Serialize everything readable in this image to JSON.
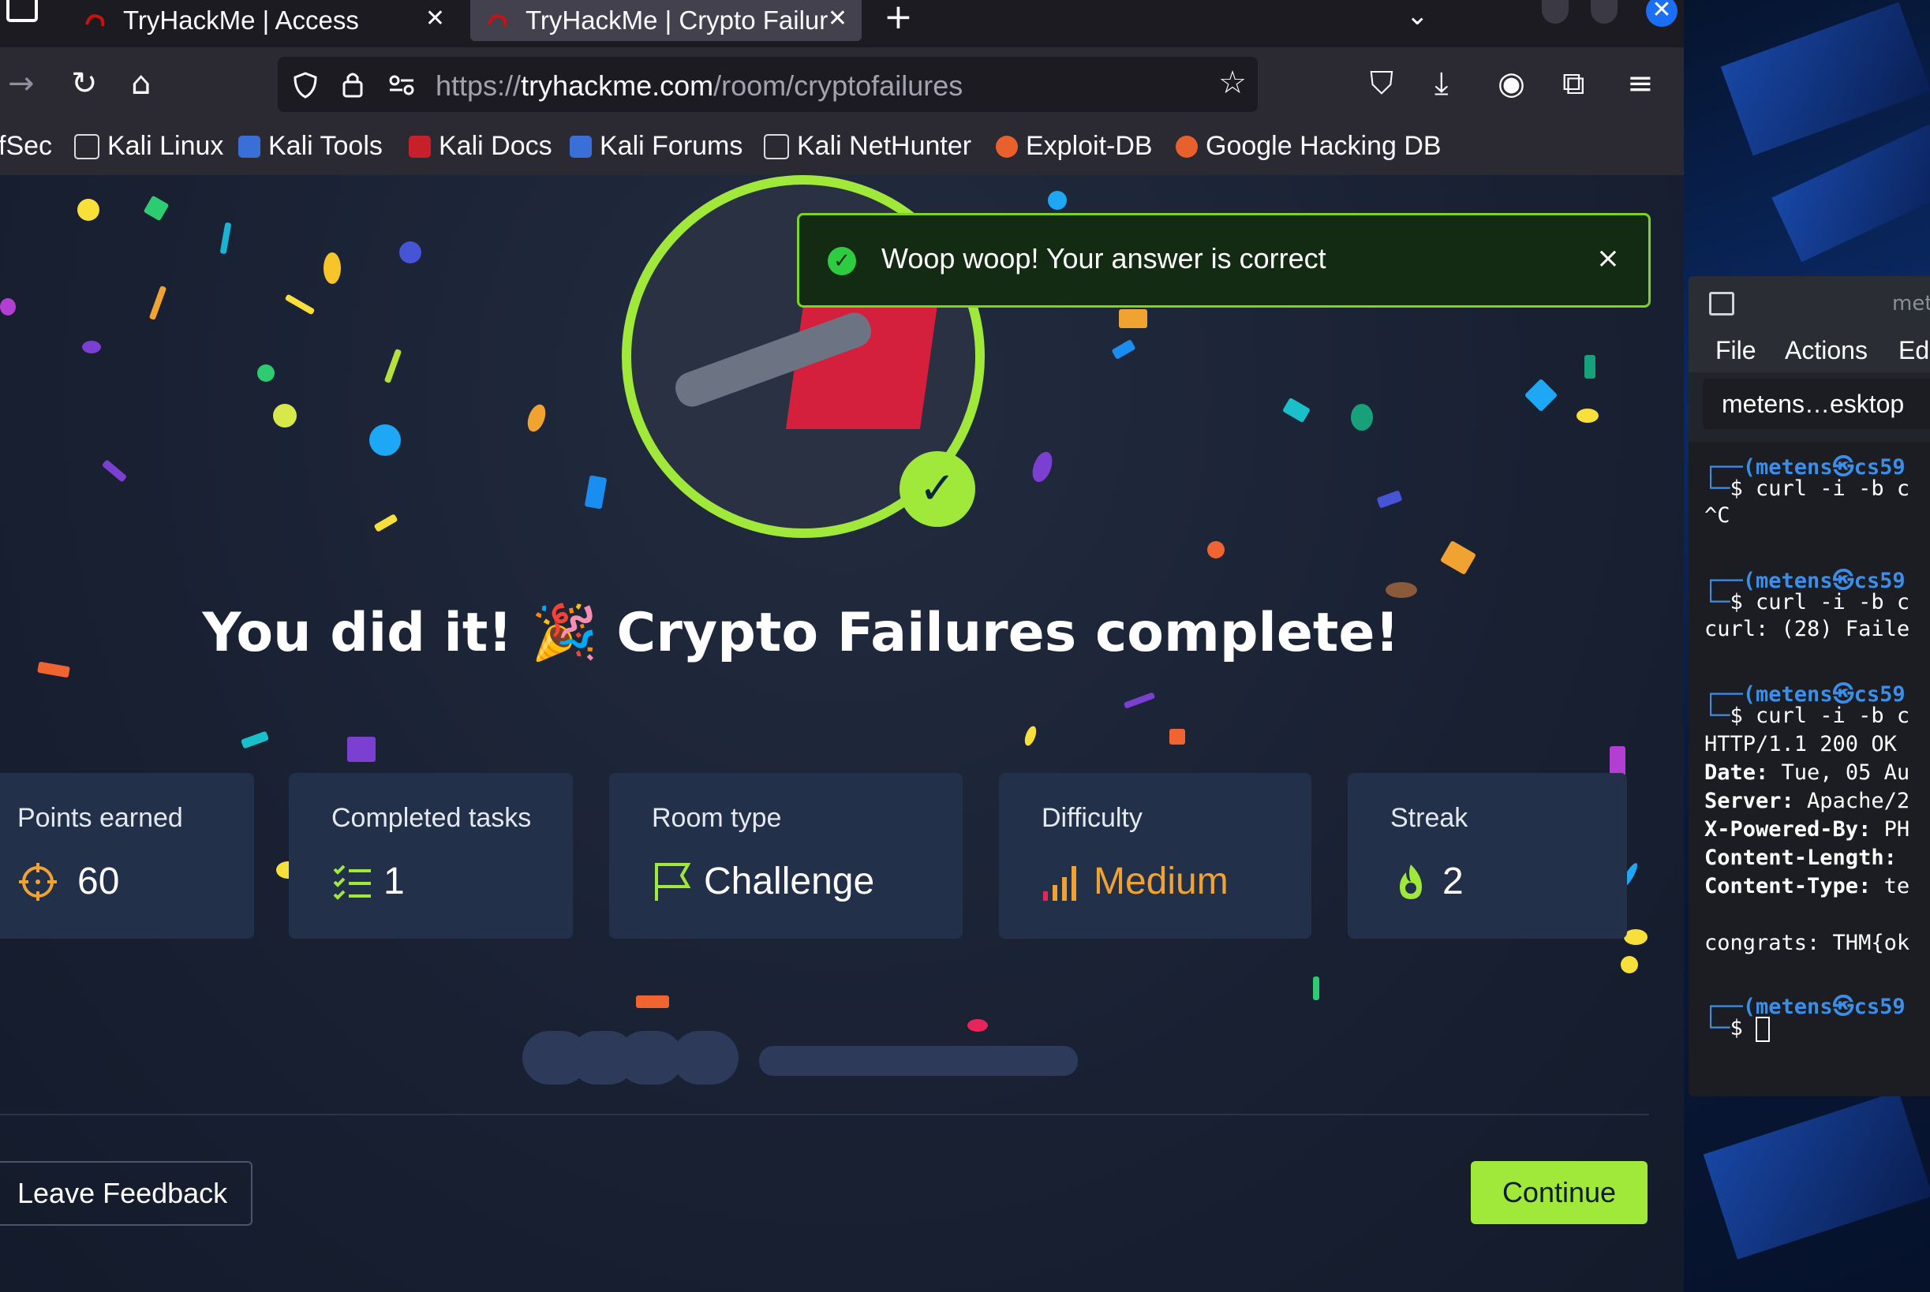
{
  "browser": {
    "tabs": [
      {
        "title": "TryHackMe | Access",
        "active": false
      },
      {
        "title": "TryHackMe | Crypto Failur",
        "active": true
      }
    ],
    "url": {
      "scheme": "https://",
      "host": "tryhackme.com",
      "path": "/room/cryptofailures"
    },
    "bookmarks": [
      "fSec",
      "Kali Linux",
      "Kali Tools",
      "Kali Docs",
      "Kali Forums",
      "Kali NetHunter",
      "Exploit-DB",
      "Google Hacking DB"
    ]
  },
  "toast": {
    "message": "Woop woop! Your answer is correct",
    "close": "×"
  },
  "headline": {
    "prefix": "You did it!",
    "emoji": "🎉",
    "suffix": "Crypto Failures complete!"
  },
  "stats": {
    "points": {
      "label": "Points earned",
      "value": "60"
    },
    "tasks": {
      "label": "Completed tasks",
      "value": "1"
    },
    "room": {
      "label": "Room type",
      "value": "Challenge"
    },
    "difficulty": {
      "label": "Difficulty",
      "value": "Medium"
    },
    "streak": {
      "label": "Streak",
      "value": "2"
    }
  },
  "footer": {
    "feedback": "Leave Feedback",
    "continue": "Continue"
  },
  "colors": {
    "accent": "#a0e93a",
    "difficulty": "#f0a331",
    "page_bg": "#1a2133",
    "card_bg": "#233049"
  },
  "terminal": {
    "title": "met",
    "menu": [
      "File",
      "Actions",
      "Ed"
    ],
    "tab": "metens…esktop",
    "lines": {
      "p1_user": "(metens㉿cs59",
      "p1_cmd": "$ curl -i -b c",
      "p1_out": "^C",
      "p2_user": "(metens㉿cs59",
      "p2_cmd": "$ curl -i -b c",
      "p2_out": "curl: (28) Faile",
      "p3_user": "(metens㉿cs59",
      "p3_cmd": "$ curl -i -b c",
      "http": "HTTP/1.1 200 OK",
      "date_k": "Date:",
      "date_v": " Tue, 05 Au",
      "server_k": "Server:",
      "server_v": " Apache/2",
      "xpb_k": "X-Powered-By:",
      "xpb_v": " PH",
      "cl_k": "Content-Length:",
      "cl_v": "",
      "ct_k": "Content-Type:",
      "ct_v": " te",
      "congrats": "congrats: THM{ok",
      "p4_user": "(metens㉿cs59",
      "p4_cmd": "$ "
    }
  }
}
